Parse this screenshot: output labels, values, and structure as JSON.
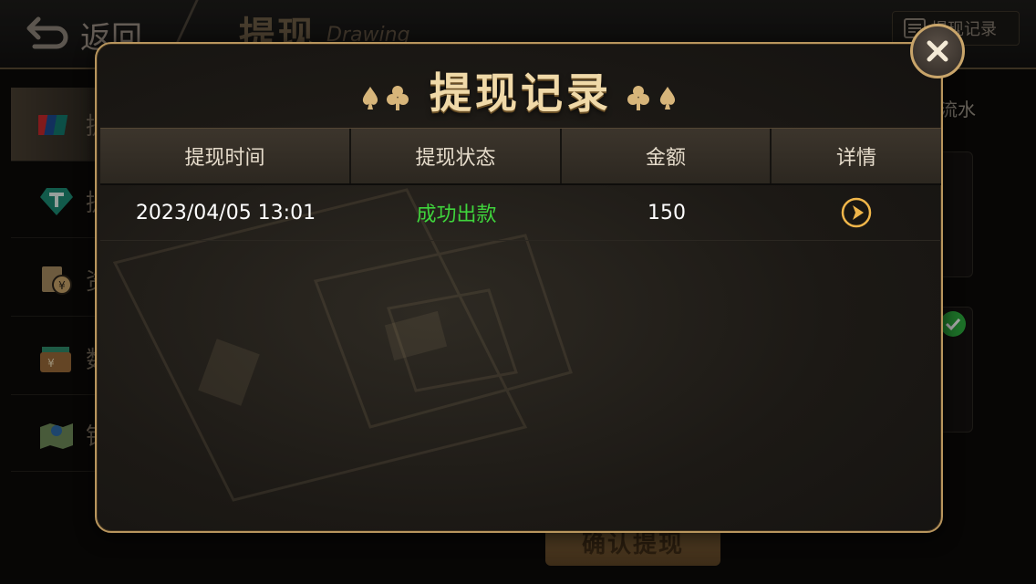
{
  "topbar": {
    "back_label": "返回",
    "title_cn": "提现",
    "title_en": "Drawing",
    "record_link_label": "提现记录"
  },
  "sidebar": {
    "items": [
      {
        "label": "提",
        "icon": "unionpay-icon",
        "active": true
      },
      {
        "label": "提",
        "icon": "tether-icon"
      },
      {
        "label": "资",
        "icon": "fund-icon"
      },
      {
        "label": "数",
        "icon": "wallet-icon"
      },
      {
        "label": "银",
        "icon": "map-icon"
      }
    ]
  },
  "right": {
    "flow_label": "流水"
  },
  "confirm_label": "确认提现",
  "dialog": {
    "title": "提现记录",
    "columns": [
      "提现时间",
      "提现状态",
      "金额",
      "详情"
    ],
    "rows": [
      {
        "time": "2023/04/05 13:01",
        "status": "成功出款",
        "amount": "150",
        "detail_icon": "arrow-right-circle-icon"
      }
    ]
  },
  "colors": {
    "accent_gold": "#b8955d",
    "status_success": "#3fd43c",
    "text_light": "#e6dccb"
  }
}
